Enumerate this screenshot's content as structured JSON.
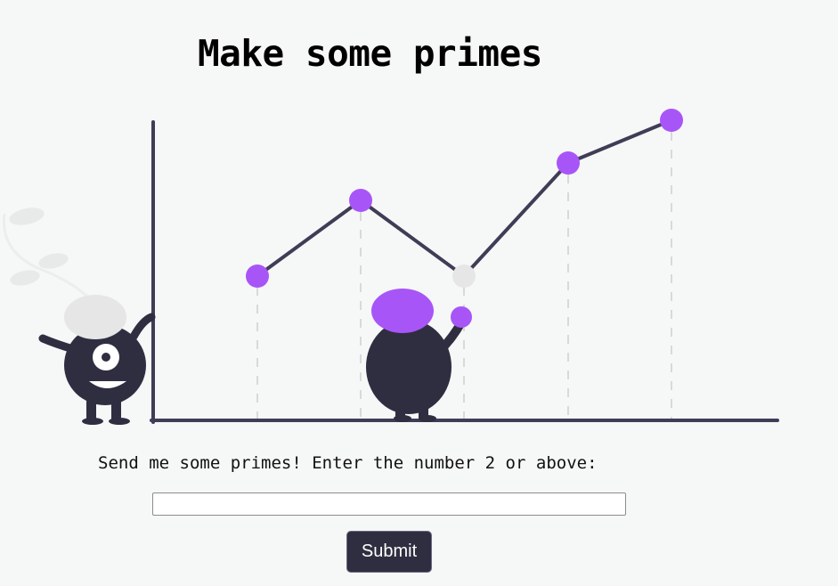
{
  "page": {
    "title": "Make some primes"
  },
  "form": {
    "prompt": "Send me some primes! Enter the number 2 or above:",
    "input_value": "",
    "input_placeholder": "",
    "submit_label": "Submit"
  },
  "illustration": {
    "accent_color": "#a855f7",
    "inactive_color": "#e6e6e6",
    "ink_color": "#2f2e41",
    "point_states": [
      "purple",
      "purple",
      "grey",
      "purple",
      "purple"
    ]
  }
}
